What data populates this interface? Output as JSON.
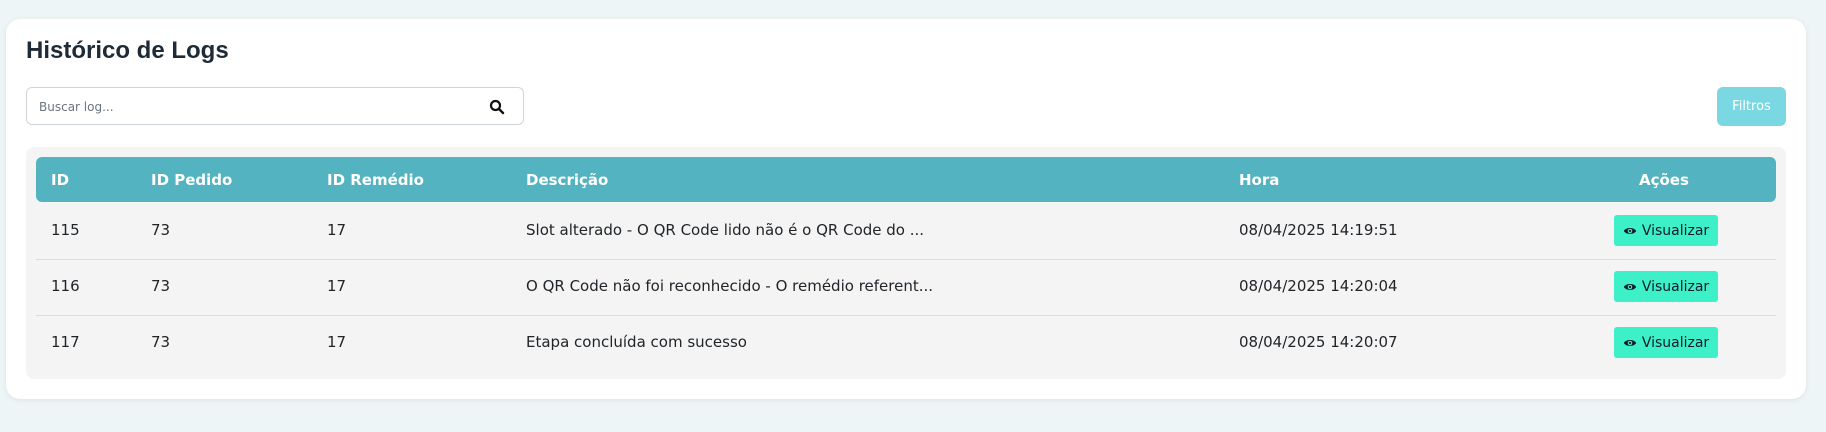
{
  "page": {
    "title": "Histórico de Logs",
    "search_placeholder": "Buscar log...",
    "filters_label": "Filtros"
  },
  "colors": {
    "header_bg": "#54b3c0",
    "view_button_bg": "#3ef0c8",
    "filters_button_bg": "#7ad8e3"
  },
  "icons": {
    "search": "search-icon",
    "view": "eye-icon"
  },
  "table": {
    "columns": [
      "ID",
      "ID Pedido",
      "ID Remédio",
      "Descrição",
      "Hora",
      "Ações"
    ],
    "rows": [
      {
        "id": "115",
        "order_id": "73",
        "medicine_id": "17",
        "description": "Slot alterado - O QR Code lido não é o QR Code do ...",
        "time": "08/04/2025 14:19:51",
        "action_label": "Visualizar"
      },
      {
        "id": "116",
        "order_id": "73",
        "medicine_id": "17",
        "description": "O QR Code não foi reconhecido - O remédio referent...",
        "time": "08/04/2025 14:20:04",
        "action_label": "Visualizar"
      },
      {
        "id": "117",
        "order_id": "73",
        "medicine_id": "17",
        "description": "Etapa concluída com sucesso",
        "time": "08/04/2025 14:20:07",
        "action_label": "Visualizar"
      }
    ]
  }
}
